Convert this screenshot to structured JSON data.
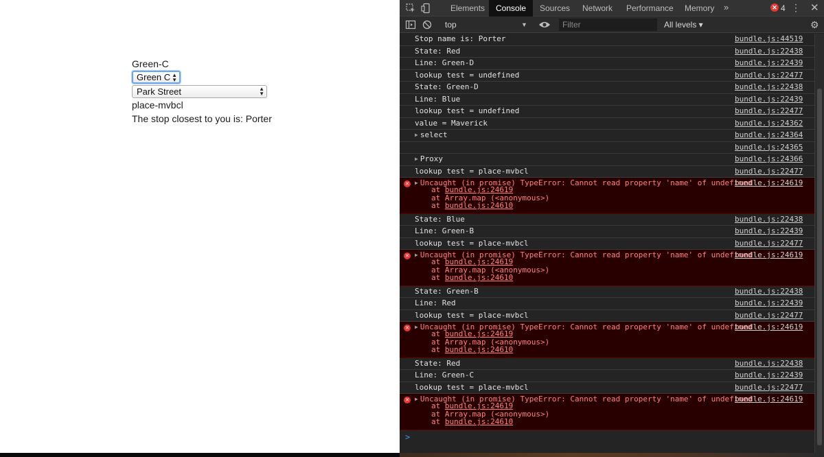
{
  "page": {
    "line_label": "Green-C",
    "line_select_value": "Green C",
    "stop_select_value": "Park Street",
    "place_id": "place-mvbcl",
    "closest_stop_text": "The stop closest to you is: Porter"
  },
  "devtools": {
    "tabs": [
      "Elements",
      "Console",
      "Sources",
      "Network",
      "Performance",
      "Memory"
    ],
    "active_tab": "Console",
    "more_tabs": "»",
    "error_count": "4",
    "context": "top",
    "filter_placeholder": "Filter",
    "log_levels": "All levels ▾",
    "prompt_symbol": ">"
  },
  "console": [
    {
      "type": "log",
      "text": "Stop name is: Porter",
      "src": "bundle.js:44519"
    },
    {
      "type": "log",
      "text": "State: Red",
      "src": "bundle.js:22438"
    },
    {
      "type": "log",
      "text": "Line: Green-D",
      "src": "bundle.js:22439"
    },
    {
      "type": "log",
      "text": "lookup test = undefined",
      "src": "bundle.js:22477"
    },
    {
      "type": "log",
      "text": "State: Green-D",
      "src": "bundle.js:22438"
    },
    {
      "type": "log",
      "text": "Line: Blue",
      "src": "bundle.js:22439"
    },
    {
      "type": "log",
      "text": "lookup test = undefined",
      "src": "bundle.js:22477"
    },
    {
      "type": "log",
      "text": "value = Maverick",
      "src": "bundle.js:24362"
    },
    {
      "type": "log",
      "text": "select",
      "src": "bundle.js:24364",
      "expandable": true
    },
    {
      "type": "log",
      "text": "",
      "src": "bundle.js:24365"
    },
    {
      "type": "log",
      "text": "Proxy",
      "src": "bundle.js:24366",
      "expandable": true
    },
    {
      "type": "log",
      "text": "lookup test = place-mvbcl",
      "src": "bundle.js:22477"
    },
    {
      "type": "error",
      "text": "Uncaught (in promise) TypeError: Cannot read property 'name' of undefined",
      "src": "bundle.js:24619",
      "stack": [
        "bundle.js:24619",
        "Array.map (<anonymous>)",
        "bundle.js:24610"
      ]
    },
    {
      "type": "log",
      "text": "State: Blue",
      "src": "bundle.js:22438"
    },
    {
      "type": "log",
      "text": "Line: Green-B",
      "src": "bundle.js:22439"
    },
    {
      "type": "log",
      "text": "lookup test = place-mvbcl",
      "src": "bundle.js:22477"
    },
    {
      "type": "error",
      "text": "Uncaught (in promise) TypeError: Cannot read property 'name' of undefined",
      "src": "bundle.js:24619",
      "stack": [
        "bundle.js:24619",
        "Array.map (<anonymous>)",
        "bundle.js:24610"
      ]
    },
    {
      "type": "log",
      "text": "State: Green-B",
      "src": "bundle.js:22438"
    },
    {
      "type": "log",
      "text": "Line: Red",
      "src": "bundle.js:22439"
    },
    {
      "type": "log",
      "text": "lookup test = place-mvbcl",
      "src": "bundle.js:22477"
    },
    {
      "type": "error",
      "text": "Uncaught (in promise) TypeError: Cannot read property 'name' of undefined",
      "src": "bundle.js:24619",
      "stack": [
        "bundle.js:24619",
        "Array.map (<anonymous>)",
        "bundle.js:24610"
      ]
    },
    {
      "type": "log",
      "text": "State: Red",
      "src": "bundle.js:22438"
    },
    {
      "type": "log",
      "text": "Line: Green-C",
      "src": "bundle.js:22439"
    },
    {
      "type": "log",
      "text": "lookup test = place-mvbcl",
      "src": "bundle.js:22477"
    },
    {
      "type": "error",
      "text": "Uncaught (in promise) TypeError: Cannot read property 'name' of undefined",
      "src": "bundle.js:24619",
      "stack": [
        "bundle.js:24619",
        "Array.map (<anonymous>)",
        "bundle.js:24610"
      ]
    }
  ],
  "colors": {
    "devtools_bg": "#242424",
    "error_bg": "#290000",
    "error_text": "#ff8080",
    "focus_ring": "#6aa6e8",
    "prompt": "#4a90e2"
  }
}
